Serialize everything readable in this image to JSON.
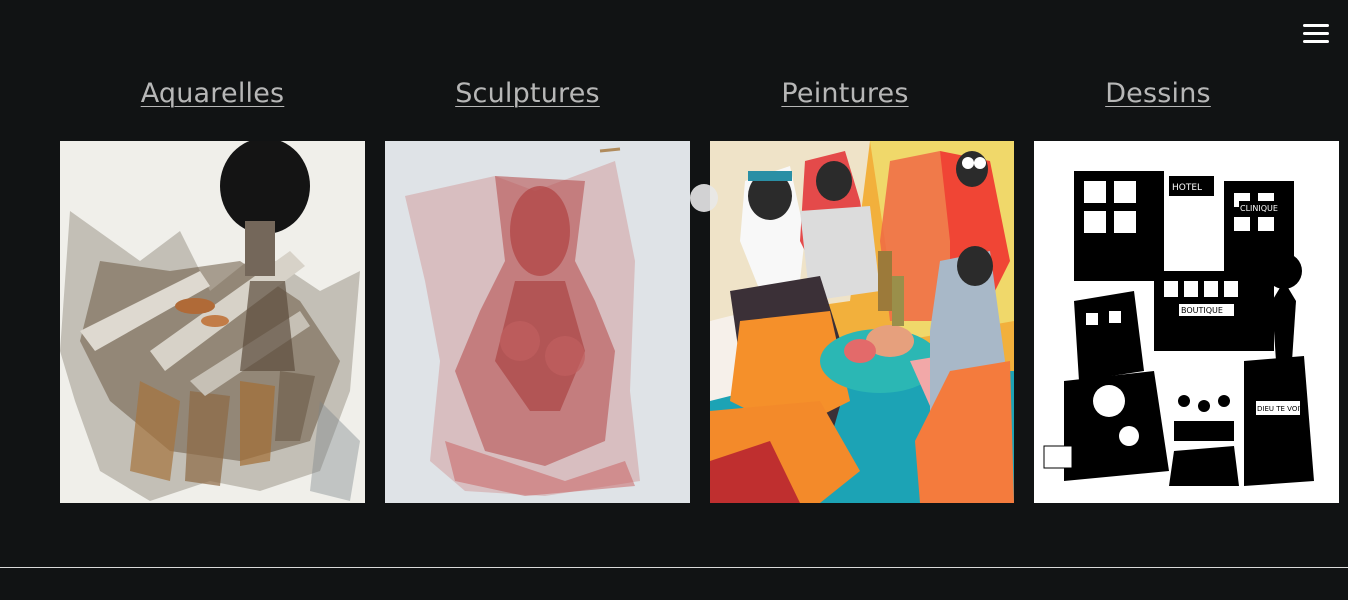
{
  "categories": [
    {
      "label": "Aquarelles"
    },
    {
      "label": "Sculptures"
    },
    {
      "label": "Peintures"
    },
    {
      "label": "Dessins"
    }
  ],
  "drawing": {
    "sign1": "HOTEL",
    "sign2": "CLINIQUE",
    "sign3": "BOUTIQUE",
    "sign4": "DIEU TE VOIT"
  },
  "menu": {
    "icon": "hamburger-menu-icon"
  },
  "colors": {
    "background": "#111314",
    "link": "#b7b7b7",
    "footer_line": "#d9d9d9"
  }
}
